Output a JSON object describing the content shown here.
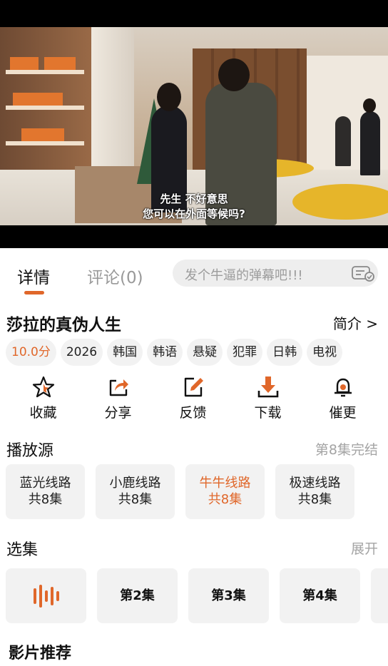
{
  "video": {
    "subtitle_line1": "先生 不好意思",
    "subtitle_line2": "您可以在外面等候吗?"
  },
  "tabs": [
    {
      "label": "详情",
      "active": true
    },
    {
      "label": "评论(0)",
      "active": false
    }
  ],
  "danmaku": {
    "placeholder": "发个牛逼的弹幕吧!!!",
    "icon": "danmaku-settings-icon"
  },
  "show": {
    "title": "莎拉的真伪人生",
    "intro_link": "简介 >",
    "tags": [
      "10.0分",
      "2026",
      "韩国",
      "韩语",
      "悬疑",
      "犯罪",
      "日韩",
      "电视"
    ]
  },
  "actions": [
    {
      "label": "收藏",
      "icon": "star-icon"
    },
    {
      "label": "分享",
      "icon": "share-icon"
    },
    {
      "label": "反馈",
      "icon": "edit-icon"
    },
    {
      "label": "下载",
      "icon": "download-icon"
    },
    {
      "label": "催更",
      "icon": "bell-icon"
    }
  ],
  "sources_section": {
    "title": "播放源",
    "status": "第8集完结",
    "items": [
      {
        "name": "蓝光线路",
        "count": "共8集",
        "active": false
      },
      {
        "name": "小鹿线路",
        "count": "共8集",
        "active": false
      },
      {
        "name": "牛牛线路",
        "count": "共8集",
        "active": true
      },
      {
        "name": "极速线路",
        "count": "共8集",
        "active": false
      }
    ]
  },
  "episodes_section": {
    "title": "选集",
    "expand": "展开",
    "items": [
      "",
      "第2集",
      "第3集",
      "第4集"
    ]
  },
  "recommend": {
    "title": "影片推荐"
  },
  "colors": {
    "accent": "#e0672a",
    "chip_bg": "#f2f2f2",
    "muted": "#a4a4a4"
  }
}
